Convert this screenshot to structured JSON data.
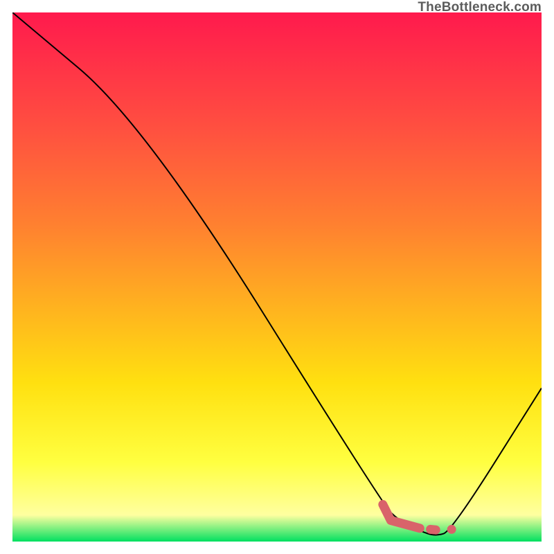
{
  "watermark": "TheBottleneck.com",
  "chart_data": {
    "type": "line",
    "title": "",
    "xlabel": "",
    "ylabel": "",
    "xlim": [
      0,
      100
    ],
    "ylim": [
      0,
      100
    ],
    "series": [
      {
        "name": "bottleneck-curve",
        "x": [
          0,
          25,
          70,
          73,
          77,
          80,
          83,
          100
        ],
        "y": [
          100,
          79,
          7,
          4,
          2,
          1,
          2,
          29
        ]
      },
      {
        "name": "marker-segment-1",
        "x": [
          70,
          71.5,
          77
        ],
        "y": [
          7,
          4,
          2.5
        ]
      },
      {
        "name": "marker-segment-2",
        "x": [
          79,
          80
        ],
        "y": [
          2.3,
          2.2
        ]
      },
      {
        "name": "marker-dot",
        "x": [
          83
        ],
        "y": [
          2.3
        ]
      }
    ],
    "gradient_colors": {
      "top": "#ff1a4d",
      "mid_upper": "#ff8030",
      "mid": "#ffe010",
      "mid_lower": "#ffffa0",
      "bottom": "#00e060"
    },
    "marker_color": "#d9636a",
    "curve_color": "#000000"
  }
}
